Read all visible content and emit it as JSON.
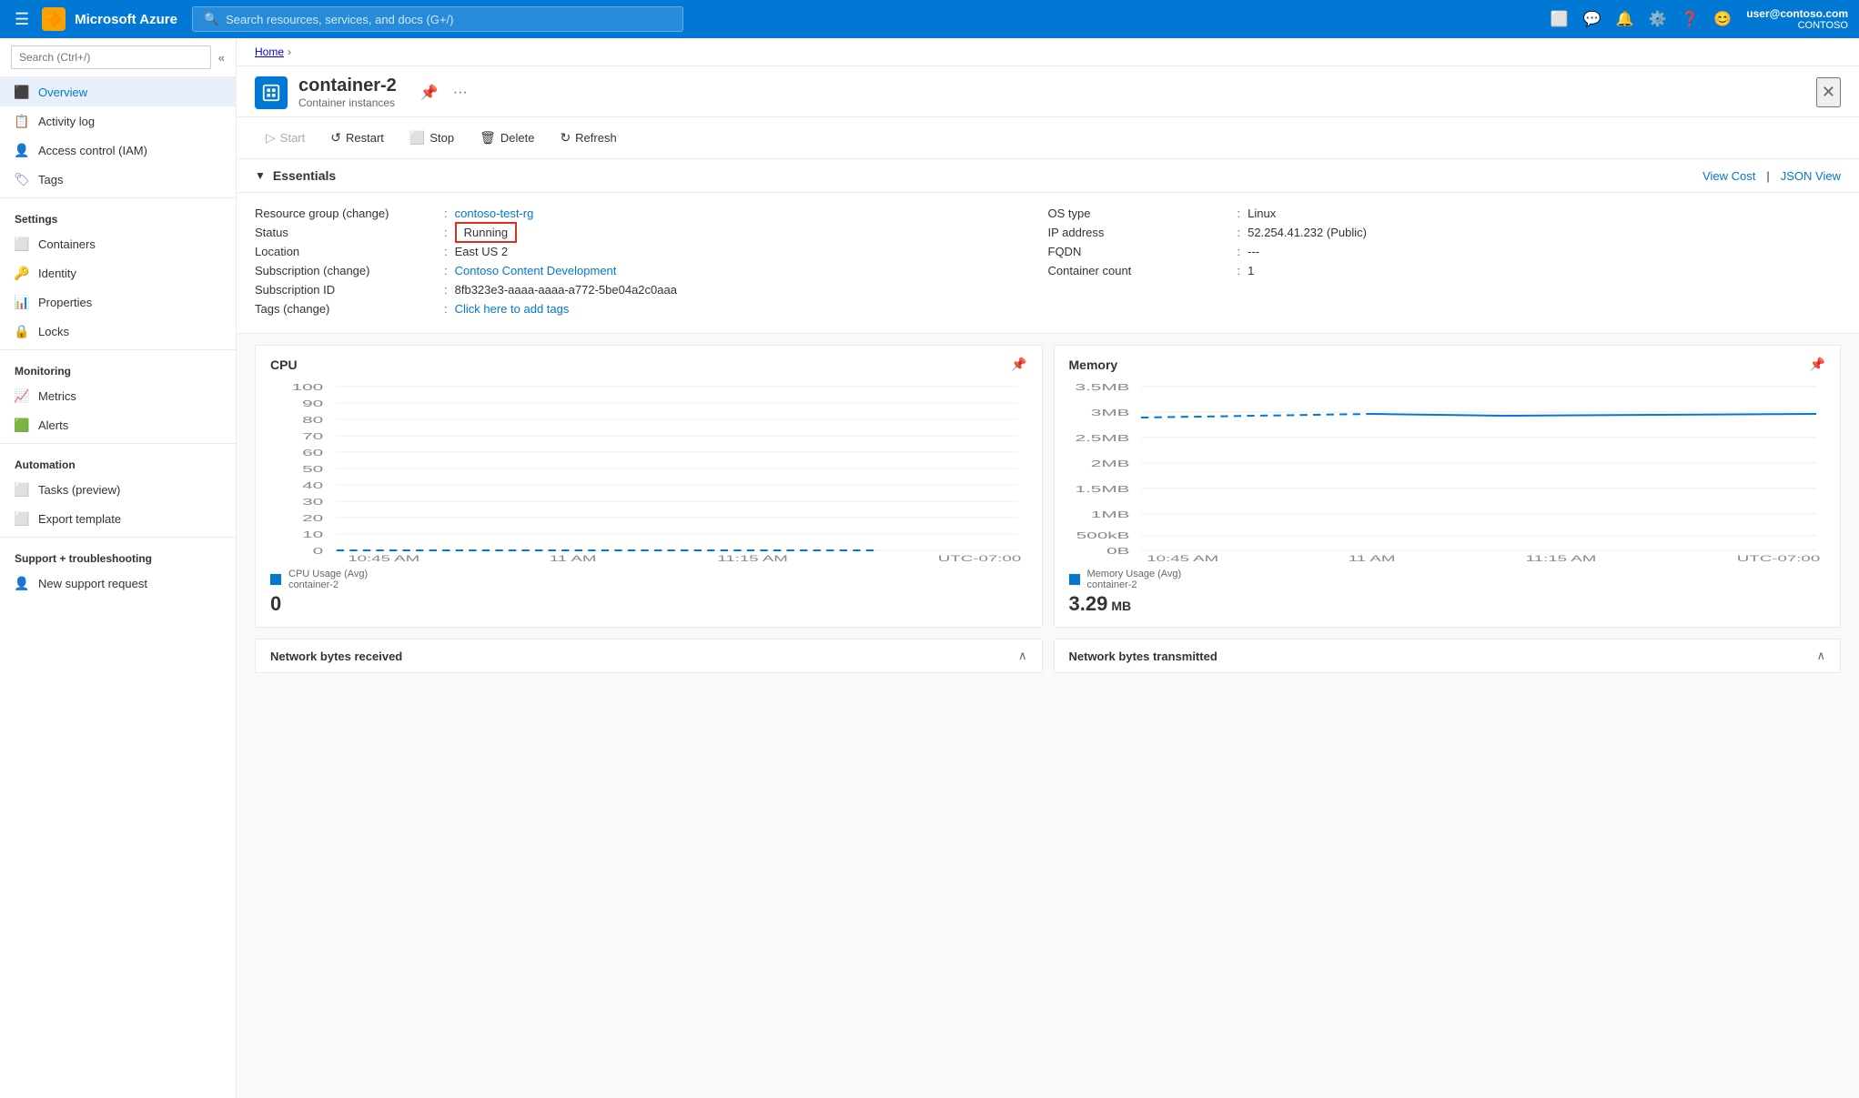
{
  "topnav": {
    "brand": "Microsoft Azure",
    "search_placeholder": "Search resources, services, and docs (G+/)",
    "user_email": "user@contoso.com",
    "user_org": "CONTOSO"
  },
  "breadcrumb": {
    "home": "Home"
  },
  "resource": {
    "name": "container-2",
    "subtitle": "Container instances",
    "icon": "📦"
  },
  "toolbar": {
    "start": "Start",
    "restart": "Restart",
    "stop": "Stop",
    "delete": "Delete",
    "refresh": "Refresh"
  },
  "essentials": {
    "title": "Essentials",
    "view_cost": "View Cost",
    "json_view": "JSON View",
    "fields": {
      "resource_group_label": "Resource group (change)",
      "resource_group_value": "contoso-test-rg",
      "status_label": "Status",
      "status_value": "Running",
      "location_label": "Location",
      "location_value": "East US 2",
      "subscription_label": "Subscription (change)",
      "subscription_value": "Contoso Content Development",
      "subscription_id_label": "Subscription ID",
      "subscription_id_value": "8fb323e3-aaaa-aaaa-a772-5be04a2c0aaa",
      "tags_label": "Tags (change)",
      "tags_value": "Click here to add tags",
      "os_type_label": "OS type",
      "os_type_value": "Linux",
      "ip_address_label": "IP address",
      "ip_address_value": "52.254.41.232 (Public)",
      "fqdn_label": "FQDN",
      "fqdn_value": "---",
      "container_count_label": "Container count",
      "container_count_value": "1"
    }
  },
  "sidebar": {
    "search_placeholder": "Search (Ctrl+/)",
    "items": [
      {
        "id": "overview",
        "label": "Overview",
        "icon": "⬛",
        "active": true
      },
      {
        "id": "activity-log",
        "label": "Activity log",
        "icon": "📋"
      },
      {
        "id": "access-control",
        "label": "Access control (IAM)",
        "icon": "👤"
      },
      {
        "id": "tags",
        "label": "Tags",
        "icon": "🏷"
      }
    ],
    "sections": [
      {
        "label": "Settings",
        "items": [
          {
            "id": "containers",
            "label": "Containers",
            "icon": "⬛"
          },
          {
            "id": "identity",
            "label": "Identity",
            "icon": "🔑"
          },
          {
            "id": "properties",
            "label": "Properties",
            "icon": "📊"
          },
          {
            "id": "locks",
            "label": "Locks",
            "icon": "🔒"
          }
        ]
      },
      {
        "label": "Monitoring",
        "items": [
          {
            "id": "metrics",
            "label": "Metrics",
            "icon": "📈"
          },
          {
            "id": "alerts",
            "label": "Alerts",
            "icon": "🟩"
          }
        ]
      },
      {
        "label": "Automation",
        "items": [
          {
            "id": "tasks",
            "label": "Tasks (preview)",
            "icon": "⬛"
          },
          {
            "id": "export-template",
            "label": "Export template",
            "icon": "⬛"
          }
        ]
      },
      {
        "label": "Support + troubleshooting",
        "items": [
          {
            "id": "new-support",
            "label": "New support request",
            "icon": "👤"
          }
        ]
      }
    ]
  },
  "charts": {
    "cpu": {
      "title": "CPU",
      "legend_label": "CPU Usage (Avg)",
      "legend_sub": "container-2",
      "value": "0",
      "x_labels": [
        "10:45 AM",
        "11 AM",
        "11:15 AM",
        "UTC-07:00"
      ],
      "y_labels": [
        "100",
        "90",
        "80",
        "70",
        "60",
        "50",
        "40",
        "30",
        "20",
        "10",
        "0"
      ]
    },
    "memory": {
      "title": "Memory",
      "legend_label": "Memory Usage (Avg)",
      "legend_sub": "container-2",
      "value": "3.29",
      "value_unit": "MB",
      "x_labels": [
        "10:45 AM",
        "11 AM",
        "11:15 AM",
        "UTC-07:00"
      ],
      "y_labels": [
        "3.5MB",
        "3MB",
        "2.5MB",
        "2MB",
        "1.5MB",
        "1MB",
        "500kB",
        "0B"
      ]
    }
  },
  "bottom_charts": {
    "network_received": "Network bytes received",
    "network_transmitted": "Network bytes transmitted"
  }
}
